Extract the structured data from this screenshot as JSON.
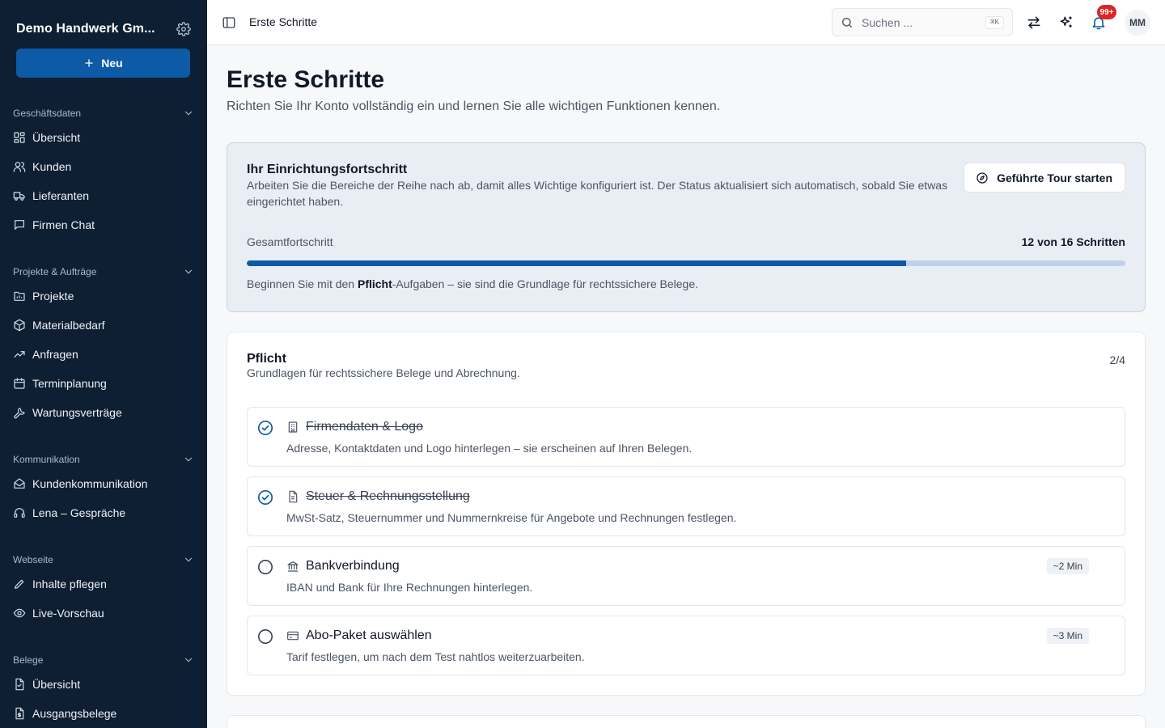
{
  "sidebar": {
    "company_name": "Demo Handwerk Gm...",
    "new_button_label": "Neu",
    "sections": [
      {
        "title": "Geschäftsdaten",
        "items": [
          "Übersicht",
          "Kunden",
          "Lieferanten",
          "Firmen Chat"
        ]
      },
      {
        "title": "Projekte & Aufträge",
        "items": [
          "Projekte",
          "Materialbedarf",
          "Anfragen",
          "Terminplanung",
          "Wartungsverträge"
        ]
      },
      {
        "title": "Kommunikation",
        "items": [
          "Kundenkommunikation",
          "Lena – Gespräche"
        ]
      },
      {
        "title": "Webseite",
        "items": [
          "Inhalte pflegen",
          "Live-Vorschau"
        ]
      },
      {
        "title": "Belege",
        "items": [
          "Übersicht",
          "Ausgangsbelege"
        ]
      }
    ]
  },
  "topbar": {
    "title": "Erste Schritte",
    "search_placeholder": "Suchen ...",
    "search_shortcut": "⌘K",
    "notification_badge": "99+",
    "avatar_initials": "MM"
  },
  "page": {
    "title": "Erste Schritte",
    "subtitle": "Richten Sie Ihr Konto vollständig ein und lernen Sie alle wichtigen Funktionen kennen."
  },
  "progress": {
    "title": "Ihr Einrichtungsfortschritt",
    "description": "Arbeiten Sie die Bereiche der Reihe nach ab, damit alles Wichtige konfiguriert ist. Der Status aktualisiert sich automatisch, sobald Sie etwas eingerichtet haben.",
    "tour_button_label": "Geführte Tour starten",
    "label": "Gesamtfortschritt",
    "count_text": "12 von 16 Schritten",
    "completed": 12,
    "total": 16,
    "hint_prefix": "Beginnen Sie mit den ",
    "hint_bold": "Pflicht",
    "hint_suffix": "-Aufgaben – sie sind die Grundlage für rechtssichere Belege."
  },
  "pflicht": {
    "title": "Pflicht",
    "subtitle": "Grundlagen für rechtssichere Belege und Abrechnung.",
    "count": "2/4",
    "tasks": [
      {
        "title": "Firmendaten & Logo",
        "description": "Adresse, Kontaktdaten und Logo hinterlegen – sie erscheinen auf Ihren Belegen.",
        "done": true,
        "icon": "building-icon",
        "badge": ""
      },
      {
        "title": "Steuer & Rechnungsstellung",
        "description": "MwSt-Satz, Steuernummer und Nummernkreise für Angebote und Rechnungen festlegen.",
        "done": true,
        "icon": "document-icon",
        "badge": ""
      },
      {
        "title": "Bankverbindung",
        "description": "IBAN und Bank für Ihre Rechnungen hinterlegen.",
        "done": false,
        "icon": "bank-icon",
        "badge": "~2 Min"
      },
      {
        "title": "Abo-Paket auswählen",
        "description": "Tarif festlegen, um nach dem Test nahtlos weiterzuarbeiten.",
        "done": false,
        "icon": "credit-card-icon",
        "badge": "~3 Min"
      }
    ]
  },
  "colors": {
    "accent": "#0d5aa7",
    "sidebar_bg": "#0f1f33",
    "badge_red": "#dc2626"
  }
}
